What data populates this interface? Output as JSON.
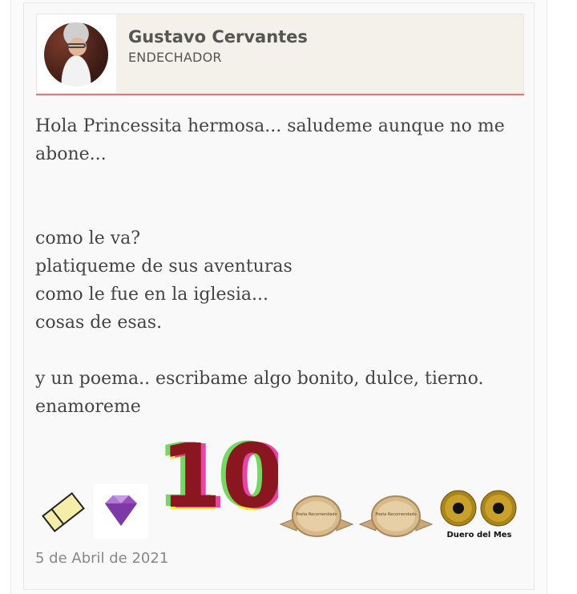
{
  "author": {
    "name": "Gustavo Cervantes",
    "rank": "ENDECHADOR"
  },
  "message": {
    "line1": "Hola Princessita hermosa... saludeme aunque no me abone...",
    "line2": "como le va?",
    "line3": "platiqueme de sus aventuras",
    "line4": "como le fue en la iglesia...",
    "line5": "cosas de esas.",
    "line6": "y un poema.. escribame algo bonito, dulce, tierno.",
    "line7": "enamoreme"
  },
  "badges": {
    "ticket": "ticket-icon",
    "gem": "gem-icon",
    "ten_number": "10",
    "medal1_text": "Poeta Recomendado",
    "medal2_text": "Poeta Recomendado",
    "gears_text": "Duero del Mes"
  },
  "date": "5 de Abril de 2021",
  "colors": {
    "divider": "#d97a78",
    "author_bg": "#f4f1ea",
    "text": "#444444"
  }
}
